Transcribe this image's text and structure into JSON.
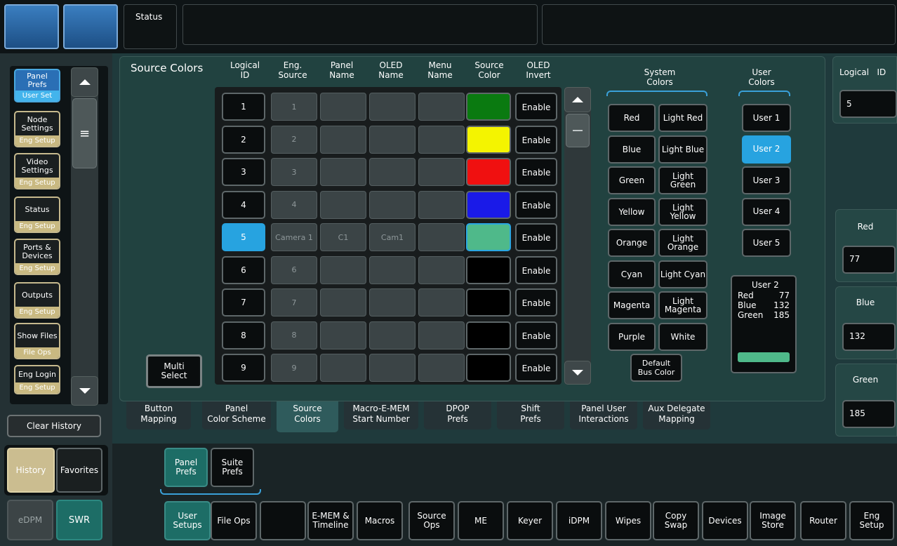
{
  "top": {
    "status_label": "Status"
  },
  "panel": {
    "title": "Source Colors",
    "headers": [
      "Logical\nID",
      "Eng.\nSource",
      "Panel\nName",
      "OLED\nName",
      "Menu\nName",
      "Source\nColor",
      "OLED\nInvert"
    ],
    "rows": [
      {
        "id": "1",
        "eng": "1",
        "panel": "",
        "oled": "",
        "menu": "",
        "color": "#0a7a10",
        "invert": "Enable"
      },
      {
        "id": "2",
        "eng": "2",
        "panel": "",
        "oled": "",
        "menu": "",
        "color": "#f4f400",
        "invert": "Enable"
      },
      {
        "id": "3",
        "eng": "3",
        "panel": "",
        "oled": "",
        "menu": "",
        "color": "#f01010",
        "invert": "Enable"
      },
      {
        "id": "4",
        "eng": "4",
        "panel": "",
        "oled": "",
        "menu": "",
        "color": "#1a1ae8",
        "invert": "Enable"
      },
      {
        "id": "5",
        "eng": "Camera 1",
        "panel": "C1",
        "oled": "Cam1",
        "menu": "",
        "color": "#4fb98a",
        "invert": "Enable",
        "selected": true
      },
      {
        "id": "6",
        "eng": "6",
        "panel": "",
        "oled": "",
        "menu": "",
        "color": "#000000",
        "invert": "Enable"
      },
      {
        "id": "7",
        "eng": "7",
        "panel": "",
        "oled": "",
        "menu": "",
        "color": "#000000",
        "invert": "Enable"
      },
      {
        "id": "8",
        "eng": "8",
        "panel": "",
        "oled": "",
        "menu": "",
        "color": "#000000",
        "invert": "Enable"
      },
      {
        "id": "9",
        "eng": "9",
        "panel": "",
        "oled": "",
        "menu": "",
        "color": "#000000",
        "invert": "Enable"
      }
    ],
    "multi_select": "Multi\nSelect",
    "system_colors_label": "System\nColors",
    "user_colors_label": "User\nColors",
    "system_colors": [
      [
        "Red",
        "Light Red"
      ],
      [
        "Blue",
        "Light Blue"
      ],
      [
        "Green",
        "Light\nGreen"
      ],
      [
        "Yellow",
        "Light\nYellow"
      ],
      [
        "Orange",
        "Light\nOrange"
      ],
      [
        "Cyan",
        "Light Cyan"
      ],
      [
        "Magenta",
        "Light\nMagenta"
      ],
      [
        "Purple",
        "White"
      ]
    ],
    "default_bus_color": "Default\nBus Color",
    "user_colors": [
      "User 1",
      "User 2",
      "User 3",
      "User 4",
      "User 5"
    ],
    "user_selected": "User 2",
    "user_info": {
      "title": "User 2",
      "red_label": "Red",
      "red_value": "77",
      "blue_label": "Blue",
      "blue_value": "132",
      "green_label": "Green",
      "green_value": "185",
      "swatch": "#4fb98a"
    }
  },
  "right_panel": {
    "logical_id_label": "Logical   ID",
    "logical_id_value": "5",
    "red_label": "Red",
    "red_value": "77",
    "blue_label": "Blue",
    "blue_value": "132",
    "green_label": "Green",
    "green_value": "185"
  },
  "sidenav": [
    {
      "title": "Panel\nPrefs",
      "sub": "User Set",
      "selected": true
    },
    {
      "title": "Node\nSettings",
      "sub": "Eng Setup"
    },
    {
      "title": "Video\nSettings",
      "sub": "Eng Setup"
    },
    {
      "title": "Status",
      "sub": "Eng Setup"
    },
    {
      "title": "Ports &\nDevices",
      "sub": "Eng Setup"
    },
    {
      "title": "Outputs",
      "sub": "Eng Setup"
    },
    {
      "title": "Show Files",
      "sub": "File Ops"
    },
    {
      "title": "Eng Login",
      "sub": "Eng Setup"
    }
  ],
  "clear_history": "Clear History",
  "history": "History",
  "favorites": "Favorites",
  "edpm": "eDPM",
  "swr": "SWR",
  "tabs": [
    {
      "label": "Button\nMapping"
    },
    {
      "label": "Panel\nColor Scheme"
    },
    {
      "label": "Source\nColors",
      "selected": true
    },
    {
      "label": "Macro-E-MEM\nStart Number"
    },
    {
      "label": "DPOP\nPrefs"
    },
    {
      "label": "Shift\nPrefs"
    },
    {
      "label": "Panel User\nInteractions"
    },
    {
      "label": "Aux Delegate\nMapping"
    }
  ],
  "sub_tabs": [
    "Panel\nPrefs",
    "Suite\nPrefs"
  ],
  "bottom_bar": [
    "User\nSetups",
    "File Ops",
    "",
    "E-MEM &\nTimeline",
    "Macros",
    "Source\nOps",
    "ME",
    "Keyer",
    "iDPM",
    "Wipes",
    "Copy\nSwap",
    "Devices",
    "Image\nStore",
    "Router",
    "Eng\nSetup"
  ]
}
